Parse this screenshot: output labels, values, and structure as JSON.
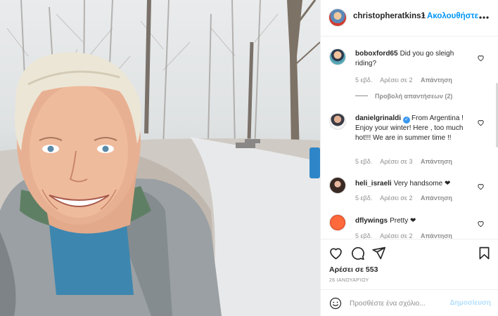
{
  "post": {
    "owner": "christopheratkins1",
    "separator": "•",
    "follow_label": "Ακολουθήστε",
    "likes_text": "Αρέσει σε 553",
    "date": "26 ΙΑΝΟΥΑΡΊΟΥ"
  },
  "comments": [
    {
      "user": "boboxford65",
      "text": "Did you go sleigh riding?",
      "time": "5 εβδ.",
      "likes": "Αρέσει σε 2",
      "reply": "Απάντηση",
      "verified": false
    },
    {
      "user": "danielgrinaldi",
      "text": "From Argentina ! Enjoy your winter! Here , too much hot!!! We are in summer time !!",
      "time": "5 εβδ.",
      "likes": "Αρέσει σε 3",
      "reply": "Απάντηση",
      "verified": true
    },
    {
      "user": "heli_israeli",
      "text": "Very handsome ❤",
      "time": "5 εβδ.",
      "likes": "Αρέσει σε 2",
      "reply": "Απάντηση",
      "verified": false
    },
    {
      "user": "dflywings",
      "text": "Pretty ❤",
      "time": "5 εβδ.",
      "likes": "Αρέσει σε 2",
      "reply": "Απάντηση",
      "verified": false
    }
  ],
  "view_replies": "Προβολή απαντήσεων (2)",
  "add_comment": {
    "placeholder": "Προσθέστε ένα σχόλιο...",
    "post_label": "Δημοσίευση"
  },
  "icons": {
    "more": "more-dots-icon",
    "like": "heart-icon",
    "comment": "comment-bubble-icon",
    "share": "paper-plane-icon",
    "save": "bookmark-icon",
    "emoji": "emoji-smile-icon",
    "comment_like": "small-heart-icon",
    "verified": "verified-badge-icon"
  },
  "colors": {
    "accent": "#0095f6",
    "text": "#262626",
    "muted": "#8e8e8e",
    "post_disabled": "#b2dffc",
    "verified": "#3897f0"
  }
}
